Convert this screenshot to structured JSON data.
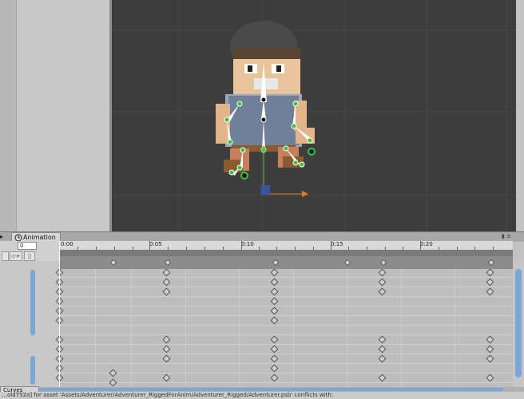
{
  "animation_tab": {
    "label": "Animation",
    "icon": "clock-icon"
  },
  "frame_field": {
    "value": "0"
  },
  "timeline": {
    "ruler_labels": [
      "0:00",
      "0:05",
      "0:10",
      "0:15",
      "0:20"
    ]
  },
  "curves_tab": {
    "label": "Curves"
  },
  "status_text": "…old752a] for asset 'Assets/Adventurer/Adventurer_RiggedForAnim/Adventurer_Rigged/Adventurer.psb' conflicts with:",
  "colors": {
    "bone": "#ffffff",
    "joint": "#36c43c",
    "pivot_axis": "#e07b20",
    "selection": "#7aa7d6"
  }
}
